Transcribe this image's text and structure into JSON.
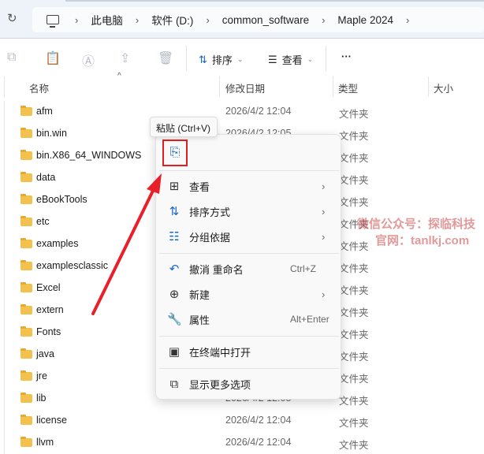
{
  "breadcrumb": {
    "items": [
      "此电脑",
      "软件 (D:)",
      "common_software",
      "Maple 2024"
    ]
  },
  "toolbar": {
    "sort": "排序",
    "view": "查看",
    "more": "···"
  },
  "columns": {
    "name": "名称",
    "date": "修改日期",
    "type": "类型",
    "size": "大小"
  },
  "files": [
    {
      "name": "afm",
      "date": "2026/4/2 12:04",
      "type": "文件夹"
    },
    {
      "name": "bin.win",
      "date": "2026/4/2 12:05",
      "type": "文件夹"
    },
    {
      "name": "bin.X86_64_WINDOWS",
      "date": "",
      "type": "文件夹"
    },
    {
      "name": "data",
      "date": "",
      "type": "文件夹"
    },
    {
      "name": "eBookTools",
      "date": "",
      "type": "文件夹"
    },
    {
      "name": "etc",
      "date": "",
      "type": "文件夹"
    },
    {
      "name": "examples",
      "date": "",
      "type": "文件夹"
    },
    {
      "name": "examplesclassic",
      "date": "",
      "type": "文件夹"
    },
    {
      "name": "Excel",
      "date": "",
      "type": "文件夹"
    },
    {
      "name": "extern",
      "date": "",
      "type": "文件夹"
    },
    {
      "name": "Fonts",
      "date": "",
      "type": "文件夹"
    },
    {
      "name": "java",
      "date": "",
      "type": "文件夹"
    },
    {
      "name": "jre",
      "date": "",
      "type": "文件夹"
    },
    {
      "name": "lib",
      "date": "2026/4/2 12:05",
      "type": "文件夹"
    },
    {
      "name": "license",
      "date": "2026/4/2 12:04",
      "type": "文件夹"
    },
    {
      "name": "llvm",
      "date": "2026/4/2 12:04",
      "type": "文件夹"
    }
  ],
  "tooltip": "粘贴 (Ctrl+V)",
  "menu": {
    "view": "查看",
    "sort": "排序方式",
    "group": "分组依据",
    "undo": "撤消 重命名",
    "undo_shortcut": "Ctrl+Z",
    "new": "新建",
    "properties": "属性",
    "properties_shortcut": "Alt+Enter",
    "terminal": "在终端中打开",
    "more": "显示更多选项"
  },
  "watermark": {
    "line1": "微信公众号：探临科技",
    "line2": "官网：tanlkj.com"
  }
}
